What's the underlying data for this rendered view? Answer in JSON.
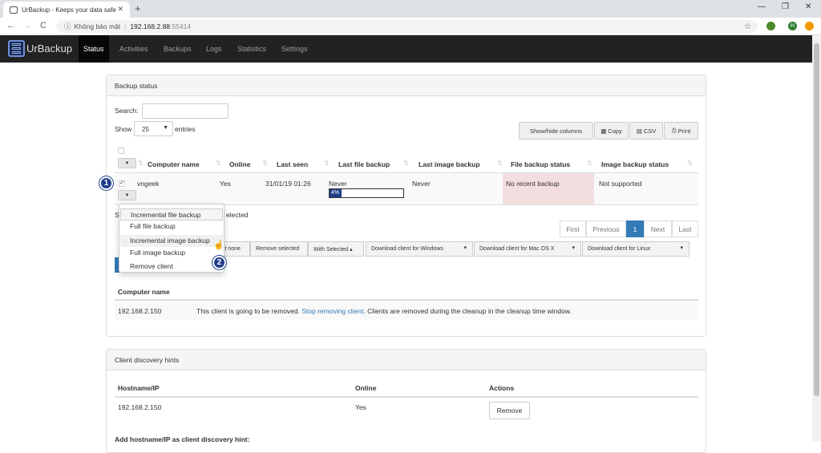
{
  "browser": {
    "tab_title": "UrBackup - Keeps your data safe",
    "security_label": "Không bảo mật",
    "url_host": "192.168.2.88",
    "url_port": ":55414",
    "profile_initial": "H"
  },
  "navbar": {
    "brand": "UrBackup",
    "items": [
      "Status",
      "Activities",
      "Backups",
      "Logs",
      "Statistics",
      "Settings"
    ],
    "active": "Status"
  },
  "backup_status": {
    "title": "Backup status",
    "search_label": "Search:",
    "show_label": "Show",
    "entries_value": "25",
    "entries_label": "entries",
    "buttons": {
      "showhide": "Show/hide columns",
      "copy": "Copy",
      "csv": "CSV",
      "print": "Print"
    },
    "columns": [
      "Computer name",
      "Online",
      "Last seen",
      "Last file backup",
      "Last image backup",
      "File backup status",
      "Image backup status"
    ],
    "row": {
      "name": "vngeek",
      "online": "Yes",
      "last_seen": "31/01/19 01:26",
      "last_file_backup": "Never",
      "progress_label": "4%",
      "progress": 0.04,
      "last_image_backup": "Never",
      "file_status": "No recent backup",
      "image_status": "Not supported"
    },
    "showing_prefix": "S",
    "selected_suffix": "elected",
    "pagination": [
      "First",
      "Previous",
      "1",
      "Next",
      "Last"
    ],
    "actions": {
      "select_none": "ct none",
      "remove_selected": "Remove selected",
      "with_selected": "With Selected ▴"
    },
    "download": [
      "Download client for Windows",
      "Download client for Mac OS X",
      "Download client for Linux"
    ],
    "context_menu": [
      "Incremental file backup",
      "Full file backup",
      "Incremental image backup",
      "Full image backup",
      "Remove client"
    ],
    "removal": {
      "header": "Computer name",
      "ip": "192.168.2.150",
      "text_before": "This client is going to be removed.",
      "link": "Stop removing client",
      "text_after": ". Clients are removed during the cleanup in the cleanup time window."
    },
    "markers": [
      "1",
      "2"
    ]
  },
  "discovery": {
    "title": "Client discovery hints",
    "columns": [
      "Hostname/IP",
      "Online",
      "Actions"
    ],
    "row": {
      "host": "192.168.2.150",
      "online": "Yes",
      "action": "Remove"
    },
    "add_label": "Add hostname/IP as client discovery hint:"
  },
  "colors": {
    "accent": "#337ab7",
    "navbar": "#222222",
    "danger_bg": "#f2dede",
    "marker": "#1f3d8a"
  }
}
